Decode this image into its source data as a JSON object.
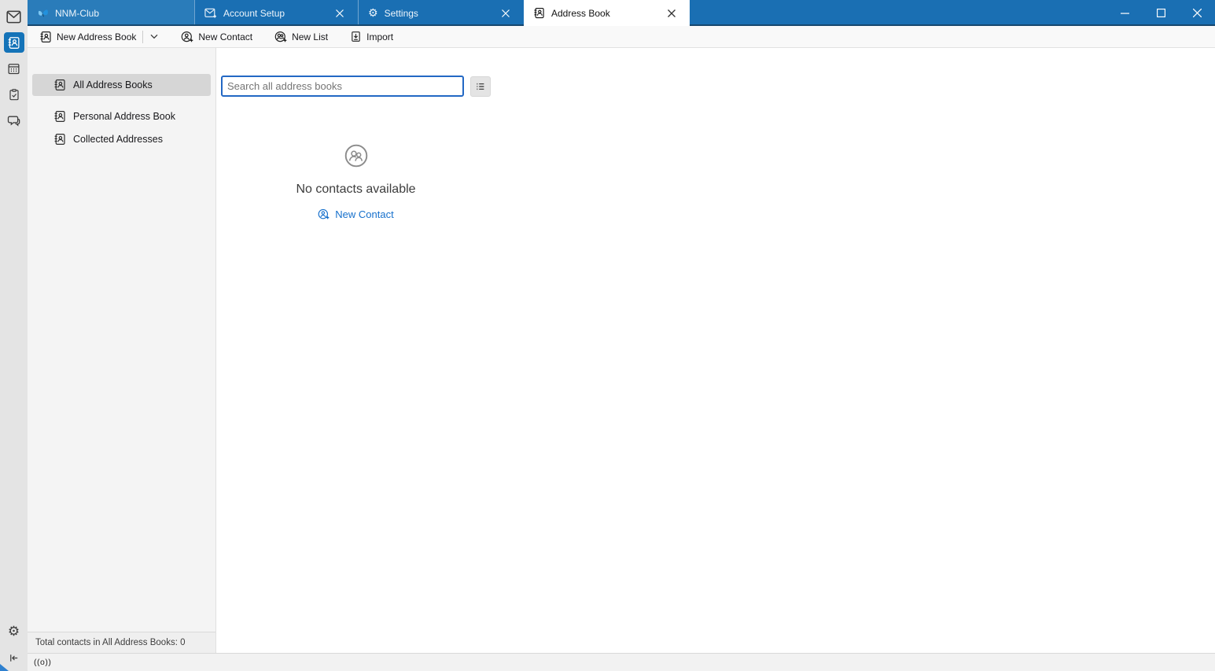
{
  "tabs": [
    {
      "label": "NNM-Club"
    },
    {
      "label": "Account Setup"
    },
    {
      "label": "Settings"
    },
    {
      "label": "Address Book"
    }
  ],
  "toolbar": {
    "new_address_book": "New Address Book",
    "new_contact": "New Contact",
    "new_list": "New List",
    "import": "Import"
  },
  "sidebar": {
    "items": [
      {
        "label": "All Address Books"
      },
      {
        "label": "Personal Address Book"
      },
      {
        "label": "Collected Addresses"
      }
    ],
    "footer": "Total contacts in All Address Books: 0"
  },
  "search": {
    "placeholder": "Search all address books"
  },
  "empty_state": {
    "message": "No contacts available",
    "action_label": "New Contact"
  },
  "statusbar": {
    "activity_icon": "((o))"
  },
  "colors": {
    "tabbar_blue": "#1a6fb3",
    "selected_space_blue": "#1473b8",
    "focus_blue": "#2368c4",
    "link_blue": "#1670cc"
  }
}
